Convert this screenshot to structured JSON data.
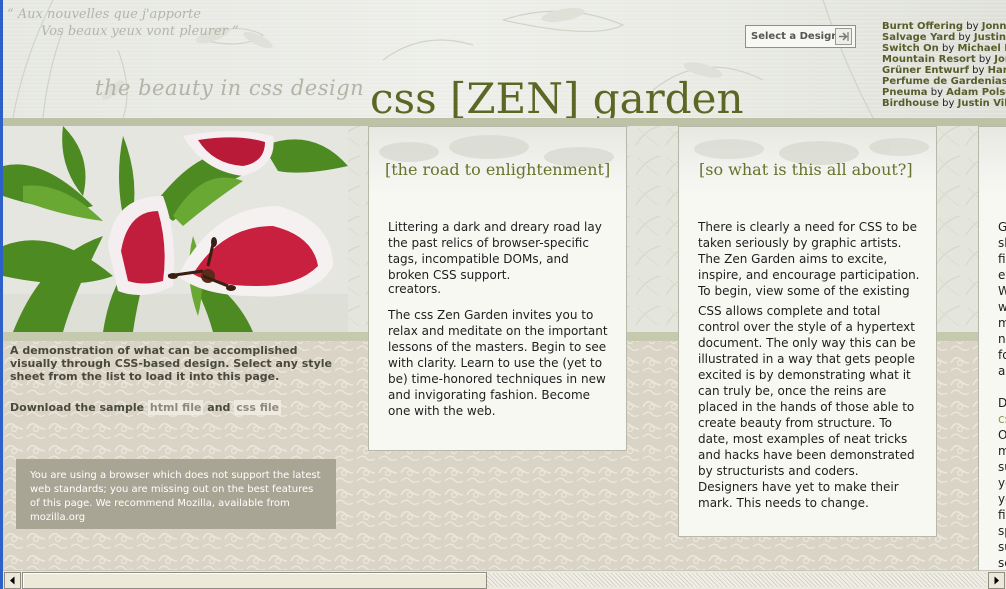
{
  "header": {
    "quote_line_1": "“ Aux nouvelles que j'apporte",
    "quote_line_2": "Vos beaux yeux vont pleurer ”",
    "tagline": "the beauty in css design",
    "site_title_prefix": "css ",
    "site_title_bracket_open": "[",
    "site_title_zen": "ZEN",
    "site_title_bracket_close": "]",
    "site_title_suffix": " garden",
    "select_design_label": "Select a Design:"
  },
  "design_list": [
    {
      "name": "Burnt Offering",
      "by": "by",
      "author": "Jonny B"
    },
    {
      "name": "Salvage Yard",
      "by": "by",
      "author": "Justin Pe"
    },
    {
      "name": "Switch On",
      "by": "by",
      "author": "Michael Fas"
    },
    {
      "name": "Mountain Resort",
      "by": "by",
      "author": "Jordi"
    },
    {
      "name": "Grüner Entwurf",
      "by": "by",
      "author": "Hanna"
    },
    {
      "name": "Perfume de Gardenias",
      "by": "by",
      "author": ""
    },
    {
      "name": "Pneuma",
      "by": "by",
      "author": "Adam Polselli"
    },
    {
      "name": "Birdhouse",
      "by": "by",
      "author": "Justin Vilela"
    }
  ],
  "intro": {
    "description": "A demonstration of what can be accomplished visually through CSS-based design. Select any style sheet from the list to load it into this page.",
    "download_prefix": "Download the sample",
    "html_file_label": "html file",
    "and_label": "and",
    "css_file_label": "css file",
    "browser_notice": "You are using a browser which does not support the latest web standards; you are missing out on the best features of this page. We recommend Mozilla, available from mozilla.org"
  },
  "cards": {
    "road": {
      "title": "[the road to enlightenment]",
      "p1": "Littering a dark and dreary road lay the past relics of browser-specific tags, incompatible DOMs, and broken CSS support.",
      "clipped": "creators.",
      "p2": "The css Zen Garden invites you to relax and meditate on the important lessons of the masters. Begin to see with clarity. Learn to use the (yet to be) time-honored techniques in new and invigorating fashion. Become one with the web."
    },
    "about": {
      "title": "[so what is this all about?]",
      "p1": "There is clearly a need for CSS to be taken seriously by graphic artists. The Zen Garden aims to excite, inspire, and encourage participation. To begin, view some of the existing",
      "p2": "CSS allows complete and total control over the style of a hypertext document. The only way this can be illustrated in a way that gets people excited is by demonstrating what it can truly be, once the reins are placed in the hands of those able to create beauty from structure. To date, most examples of neat tricks and hacks have been demonstrated by structurists and coders. Designers have yet to make their mark. This needs to change."
    },
    "third": {
      "fragments": [
        "Gr",
        "sk",
        "fil",
        "ev",
        "W",
        "wi",
        "m",
        "ne",
        "fo",
        "ar",
        "",
        "Do",
        "cs",
        "Or",
        "m",
        "su",
        "yo",
        "yo",
        "fil",
        "sp",
        "su",
        "se"
      ]
    }
  },
  "colors": {
    "olive": "#5d6624",
    "bar": "#bdc1a6",
    "card_bg": "#f8f8f3",
    "notice_bg": "#a8a595"
  }
}
